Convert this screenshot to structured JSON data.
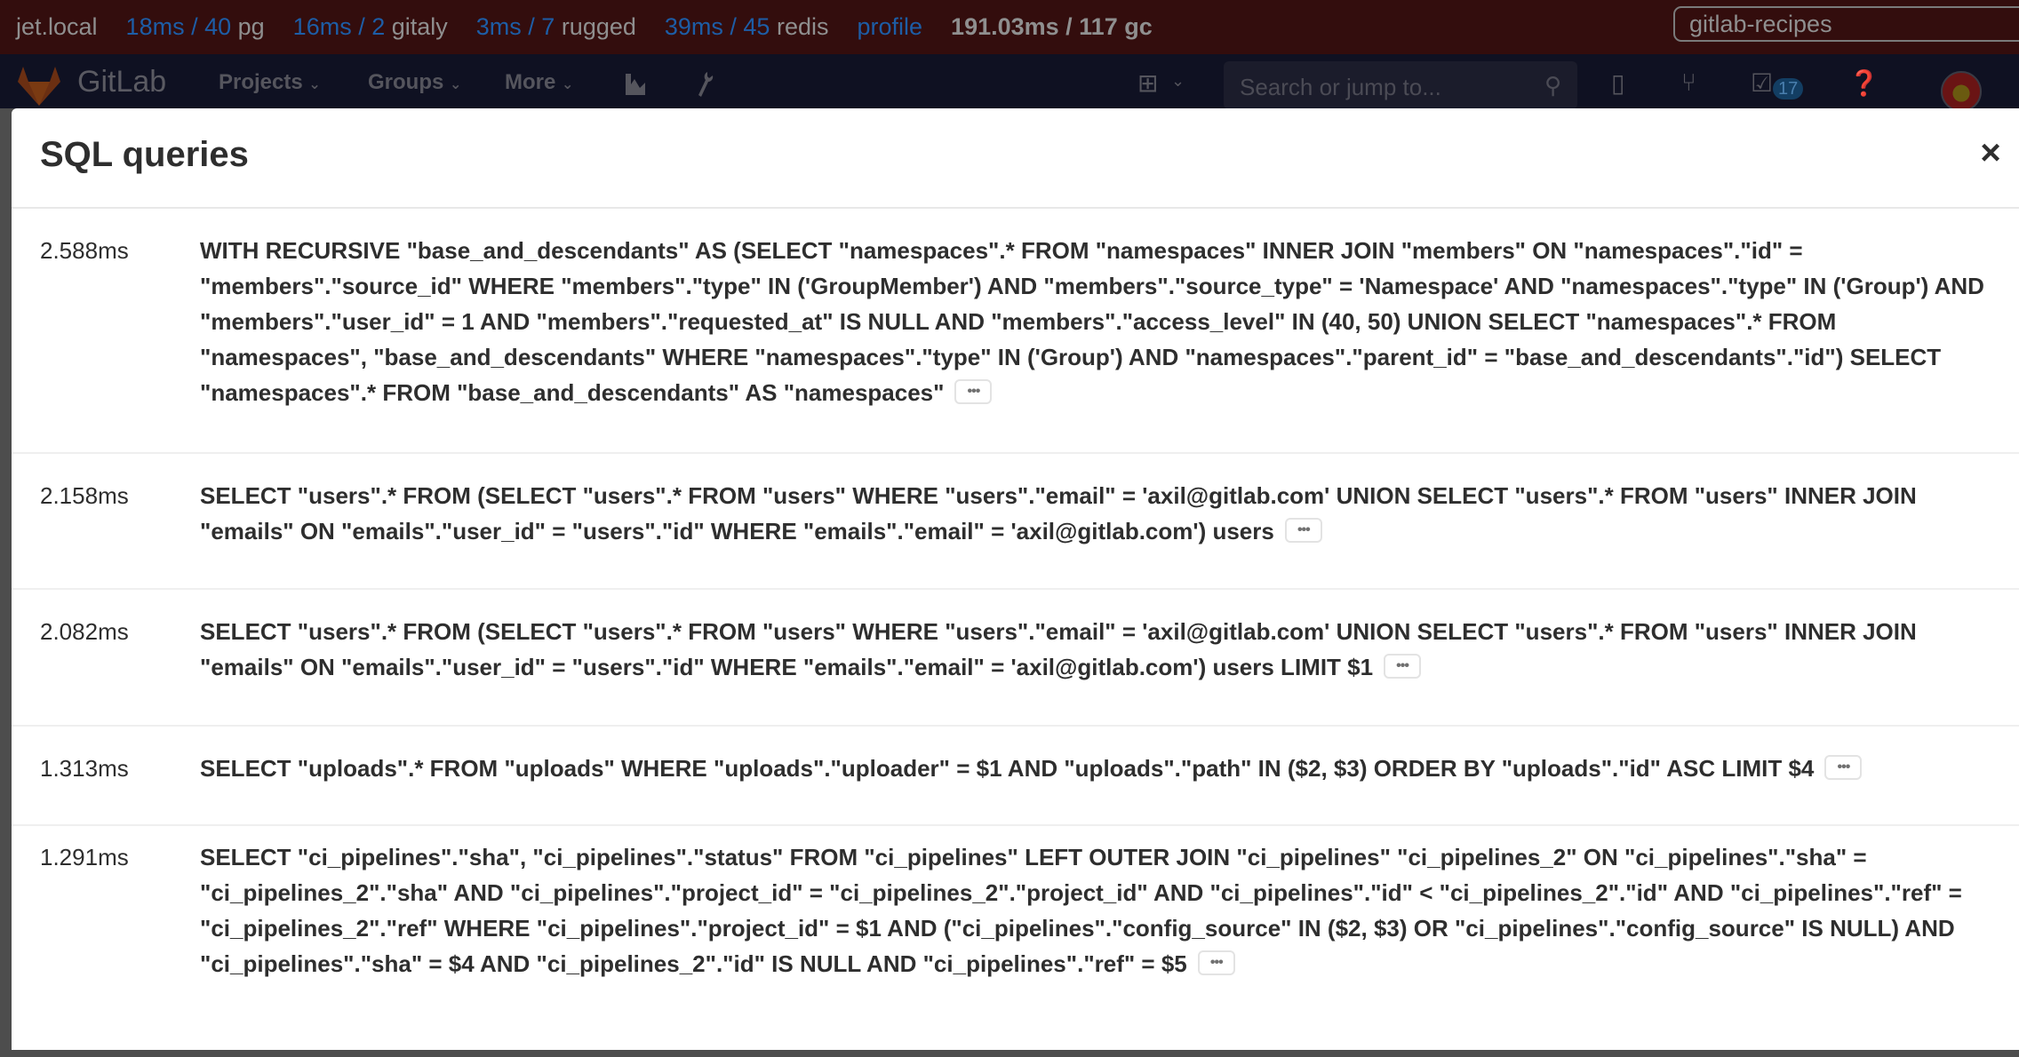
{
  "perf_bar": {
    "host": "jet.local",
    "metrics": [
      {
        "value": "18ms / 40",
        "label": "pg"
      },
      {
        "value": "16ms / 2",
        "label": "gitaly"
      },
      {
        "value": "3ms / 7",
        "label": "rugged"
      },
      {
        "value": "39ms / 45",
        "label": "redis"
      }
    ],
    "profile_link": "profile",
    "gc": "191.03ms / 117 gc",
    "request_selector": "gitlab-recipes"
  },
  "navbar": {
    "brand": "GitLab",
    "links": [
      "Projects",
      "Groups",
      "More"
    ],
    "search_placeholder": "Search or jump to...",
    "todos_count": "17",
    "icons": [
      "activity-chart-icon",
      "admin-wrench-icon",
      "new-plus-icon",
      "issues-icon",
      "merge-request-icon",
      "todo-icon",
      "help-icon",
      "user-avatar"
    ]
  },
  "modal": {
    "title": "SQL queries",
    "close_label": "×",
    "more_label": "•••",
    "queries": [
      {
        "duration": "2.588ms",
        "sql": "WITH RECURSIVE \"base_and_descendants\" AS (SELECT \"namespaces\".* FROM \"namespaces\" INNER JOIN \"members\" ON \"namespaces\".\"id\" = \"members\".\"source_id\" WHERE \"members\".\"type\" IN ('GroupMember') AND \"members\".\"source_type\" = 'Namespace' AND \"namespaces\".\"type\" IN ('Group') AND \"members\".\"user_id\" = 1 AND \"members\".\"requested_at\" IS NULL AND \"members\".\"access_level\" IN (40, 50) UNION SELECT \"namespaces\".* FROM \"namespaces\", \"base_and_descendants\" WHERE \"namespaces\".\"type\" IN ('Group') AND \"namespaces\".\"parent_id\" = \"base_and_descendants\".\"id\") SELECT \"namespaces\".* FROM \"base_and_descendants\" AS \"namespaces\""
      },
      {
        "duration": "2.158ms",
        "sql": "SELECT \"users\".* FROM (SELECT \"users\".* FROM \"users\" WHERE \"users\".\"email\" = 'axil@gitlab.com' UNION SELECT \"users\".* FROM \"users\" INNER JOIN \"emails\" ON \"emails\".\"user_id\" = \"users\".\"id\" WHERE \"emails\".\"email\" = 'axil@gitlab.com') users"
      },
      {
        "duration": "2.082ms",
        "sql": "SELECT \"users\".* FROM (SELECT \"users\".* FROM \"users\" WHERE \"users\".\"email\" = 'axil@gitlab.com' UNION SELECT \"users\".* FROM \"users\" INNER JOIN \"emails\" ON \"emails\".\"user_id\" = \"users\".\"id\" WHERE \"emails\".\"email\" = 'axil@gitlab.com') users LIMIT $1"
      },
      {
        "duration": "1.313ms",
        "sql": "SELECT \"uploads\".* FROM \"uploads\" WHERE \"uploads\".\"uploader\" = $1 AND \"uploads\".\"path\" IN ($2, $3) ORDER BY \"uploads\".\"id\" ASC LIMIT $4"
      },
      {
        "duration": "1.291ms",
        "sql": "SELECT \"ci_pipelines\".\"sha\", \"ci_pipelines\".\"status\" FROM \"ci_pipelines\" LEFT OUTER JOIN \"ci_pipelines\" \"ci_pipelines_2\" ON \"ci_pipelines\".\"sha\" = \"ci_pipelines_2\".\"sha\" AND \"ci_pipelines\".\"project_id\" = \"ci_pipelines_2\".\"project_id\" AND \"ci_pipelines\".\"id\" < \"ci_pipelines_2\".\"id\" AND \"ci_pipelines\".\"ref\" = \"ci_pipelines_2\".\"ref\" WHERE \"ci_pipelines\".\"project_id\" = $1 AND (\"ci_pipelines\".\"config_source\" IN ($2, $3) OR \"ci_pipelines\".\"config_source\" IS NULL) AND \"ci_pipelines\".\"sha\" = $4 AND \"ci_pipelines_2\".\"id\" IS NULL AND \"ci_pipelines\".\"ref\" = $5"
      }
    ]
  },
  "colors": {
    "perf_bar_bg": "#330d0d",
    "perf_metric_blue": "#1d5da6",
    "navbar_bg": "#0f1122",
    "modal_bg": "#ffffff",
    "text": "#2e2e2e",
    "divider": "#efefef"
  }
}
